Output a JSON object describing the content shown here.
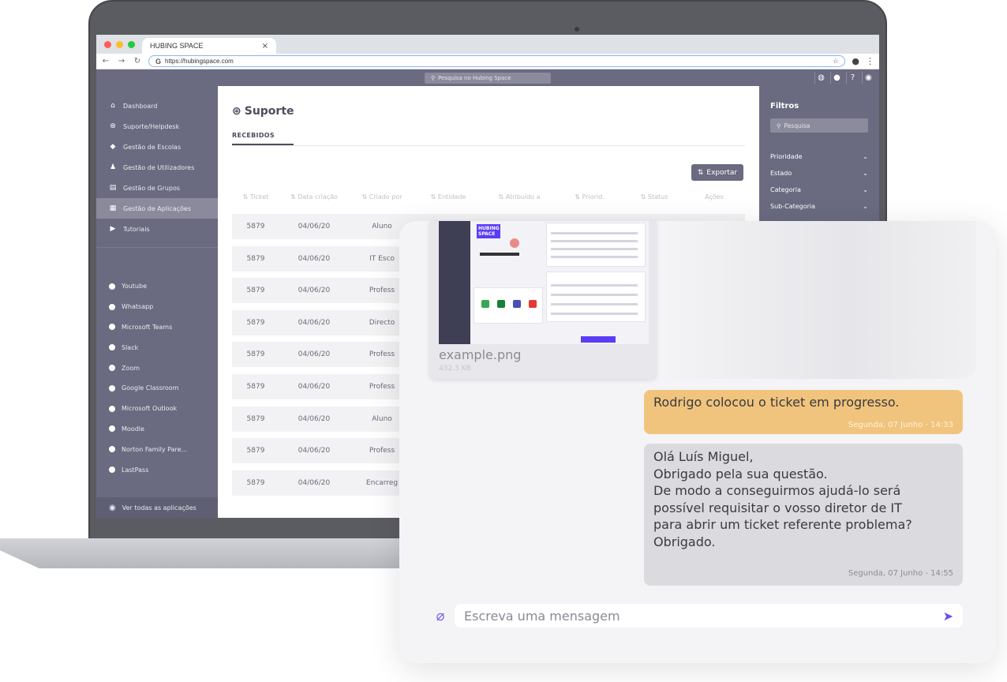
{
  "browser": {
    "tab_title": "HUBING SPACE",
    "tab_close": "×",
    "url": "https://hubingspace.com",
    "search_placeholder": "Pesquisa no Hubing Space"
  },
  "sidebar": {
    "items": [
      {
        "label": "Dashboard",
        "icon": "home-icon"
      },
      {
        "label": "Suporte/Helpdesk",
        "icon": "lifebuoy-icon"
      },
      {
        "label": "Gestão de Escolas",
        "icon": "graduation-cap-icon"
      },
      {
        "label": "Gestão de Utilizadores",
        "icon": "users-icon"
      },
      {
        "label": "Gestão de Grupos",
        "icon": "group-icon"
      },
      {
        "label": "Gestão de Aplicações",
        "icon": "grid-icon",
        "active": true
      },
      {
        "label": "Tutoriais",
        "icon": "play-icon"
      }
    ],
    "apps": [
      "Youtube",
      "Whatsapp",
      "Microsoft Teams",
      "Slack",
      "Zoom",
      "Google Classroom",
      "Microsoft Outlook",
      "Moodle",
      "Norton Family Pare...",
      "LastPass"
    ],
    "footer": "Ver todas as aplicações"
  },
  "main": {
    "title": "Suporte",
    "tab": "RECEBIDOS",
    "export_label": "Exportar",
    "columns": [
      "⇅ Ticket",
      "⇅ Data criação",
      "⇅ Criado por",
      "⇅ Entidade",
      "⇅ Atribuído a",
      "⇅ Priorid.",
      "⇅ Status",
      "Ações"
    ],
    "rows": [
      [
        "5879",
        "04/06/20",
        "Aluno"
      ],
      [
        "5879",
        "04/06/20",
        "IT Esco"
      ],
      [
        "5879",
        "04/06/20",
        "Profess"
      ],
      [
        "5879",
        "04/06/20",
        "Directo"
      ],
      [
        "5879",
        "04/06/20",
        "Profess"
      ],
      [
        "5879",
        "04/06/20",
        "Profess"
      ],
      [
        "5879",
        "04/06/20",
        "Aluno"
      ],
      [
        "5879",
        "04/06/20",
        "Profess"
      ],
      [
        "5879",
        "04/06/20",
        "Encarreg"
      ]
    ]
  },
  "filters": {
    "title": "Filtros",
    "search_placeholder": "Pesquisa",
    "groups": [
      "Prioridade",
      "Estado",
      "Categoria",
      "Sub-Categoria"
    ]
  },
  "chat": {
    "attachment": {
      "name": "example.png",
      "size": "432.3 KB",
      "thumb_brand": "HUBING SPACE"
    },
    "messages": [
      {
        "text": "Rodrigo colocou o ticket em progresso.",
        "time": "Segunda, 07 Junho - 14:33",
        "type": "system"
      },
      {
        "lines": [
          "Olá Luís Miguel,",
          "Obrigado pela sua questão.",
          "De modo a conseguirmos ajudá-lo será",
          "possível requisitar o vosso diretor de IT",
          "para abrir um ticket referente problema?",
          "Obrigado."
        ],
        "time": "Segunda, 07 Junho - 14:55",
        "type": "agent"
      }
    ],
    "composer_placeholder": "Escreva uma mensagem"
  },
  "colors": {
    "sidebar": "#6a6a80",
    "system_bubble": "#f0c47c",
    "accent": "#6c4cf2"
  }
}
